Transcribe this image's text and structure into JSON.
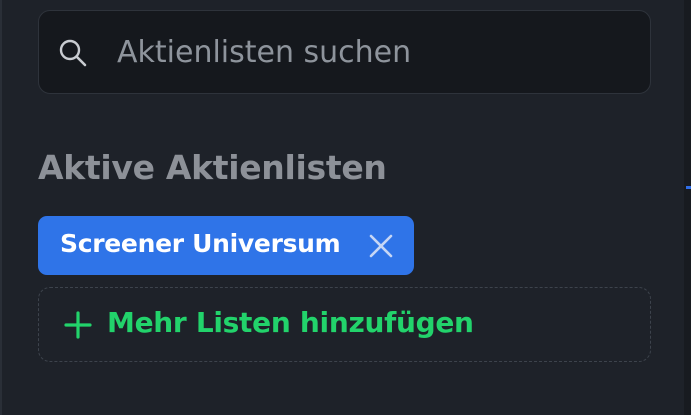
{
  "search": {
    "placeholder": "Aktienlisten suchen",
    "value": "",
    "icon": "search-icon"
  },
  "section": {
    "title": "Aktive Aktienlisten"
  },
  "active_lists": [
    {
      "label": "Screener Universum",
      "remove_icon": "close-icon"
    }
  ],
  "add_more": {
    "label": "Mehr Listen hinzufügen",
    "icon": "plus-icon"
  },
  "colors": {
    "background": "#1e2229",
    "search_background": "#15181d",
    "chip": "#2f74e8",
    "add_accent": "#22d36b",
    "muted_text": "#8d9198"
  }
}
